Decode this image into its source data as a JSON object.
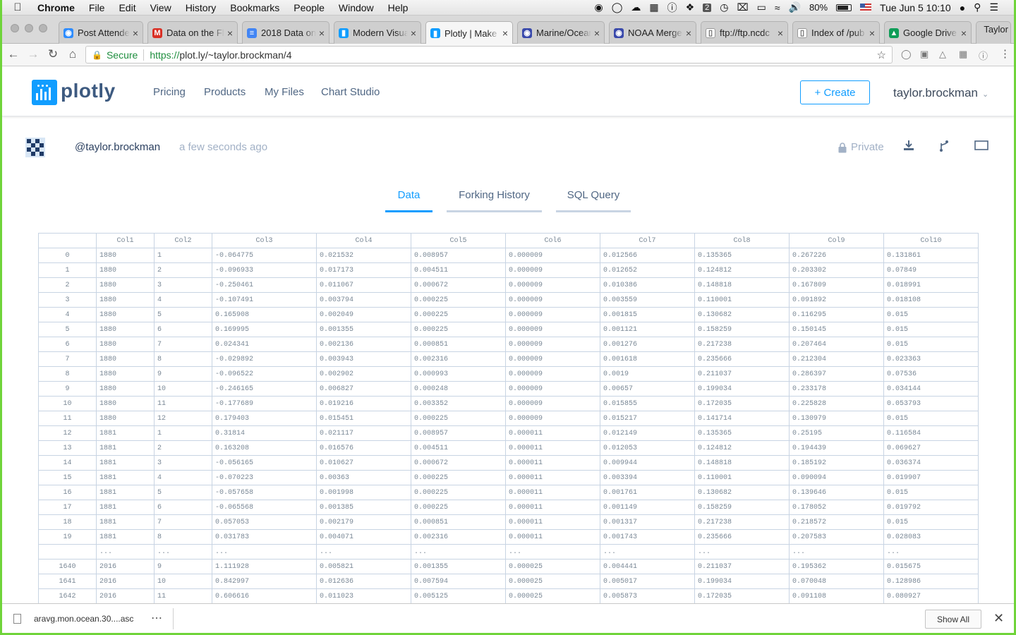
{
  "menubar": {
    "app": "Chrome",
    "items": [
      "File",
      "Edit",
      "View",
      "History",
      "Bookmarks",
      "People",
      "Window",
      "Help"
    ],
    "battery": "80%",
    "clock": "Tue Jun 5  10:10",
    "badge": "2"
  },
  "tabs": [
    {
      "title": "Post Attendee",
      "favicon_color": "#2d8cff",
      "favicon_glyph": "◉"
    },
    {
      "title": "Data on the Fly",
      "favicon_color": "#d93025",
      "favicon_glyph": "M"
    },
    {
      "title": "2018 Data on",
      "favicon_color": "#4285f4",
      "favicon_glyph": "≡"
    },
    {
      "title": "Modern Visual",
      "favicon_color": "#119dff",
      "favicon_glyph": "▮"
    },
    {
      "title": "Plotly | Make",
      "favicon_color": "#119dff",
      "favicon_glyph": "▮"
    },
    {
      "title": "Marine/Ocean",
      "favicon_color": "#3949ab",
      "favicon_glyph": "◉"
    },
    {
      "title": "NOAA Merged",
      "favicon_color": "#3949ab",
      "favicon_glyph": "◉"
    },
    {
      "title": "ftp://ftp.ncdc",
      "favicon_color": "#ffffff",
      "favicon_glyph": "▯"
    },
    {
      "title": "Index of /pub",
      "favicon_color": "#ffffff",
      "favicon_glyph": "▯"
    },
    {
      "title": "Google Drive",
      "favicon_color": "#0f9d58",
      "favicon_glyph": "▲"
    },
    {
      "title": "",
      "favicon_color": "#ffffff",
      "favicon_glyph": ""
    }
  ],
  "profile_name": "Taylor",
  "address": {
    "secure_label": "Secure",
    "scheme": "https://",
    "rest": "plot.ly/~taylor.brockman/4"
  },
  "site": {
    "logo_text": "plotly",
    "nav": [
      "Pricing",
      "Products",
      "My Files",
      "Chart Studio"
    ],
    "create_label": "+ Create",
    "user": "taylor.brockman"
  },
  "meta": {
    "username": "@taylor.brockman",
    "timeago": "a few seconds ago",
    "privacy": "Private"
  },
  "page_tabs": [
    "Data",
    "Forking History",
    "SQL Query"
  ],
  "table": {
    "columns": [
      "",
      "Col1",
      "Col2",
      "Col3",
      "Col4",
      "Col5",
      "Col6",
      "Col7",
      "Col8",
      "Col9",
      "Col10"
    ],
    "rows": [
      [
        "0",
        "1880",
        "1",
        "-0.064775",
        "0.021532",
        "0.008957",
        "0.000009",
        "0.012566",
        "0.135365",
        "0.267226",
        "0.131861"
      ],
      [
        "1",
        "1880",
        "2",
        "-0.096933",
        "0.017173",
        "0.004511",
        "0.000009",
        "0.012652",
        "0.124812",
        "0.203302",
        "0.07849"
      ],
      [
        "2",
        "1880",
        "3",
        "-0.250461",
        "0.011067",
        "0.000672",
        "0.000009",
        "0.010386",
        "0.148818",
        "0.167809",
        "0.018991"
      ],
      [
        "3",
        "1880",
        "4",
        "-0.107491",
        "0.003794",
        "0.000225",
        "0.000009",
        "0.003559",
        "0.110001",
        "0.091892",
        "0.018108"
      ],
      [
        "4",
        "1880",
        "5",
        "0.165908",
        "0.002049",
        "0.000225",
        "0.000009",
        "0.001815",
        "0.130682",
        "0.116295",
        "0.015"
      ],
      [
        "5",
        "1880",
        "6",
        "0.169995",
        "0.001355",
        "0.000225",
        "0.000009",
        "0.001121",
        "0.158259",
        "0.150145",
        "0.015"
      ],
      [
        "6",
        "1880",
        "7",
        "0.024341",
        "0.002136",
        "0.000851",
        "0.000009",
        "0.001276",
        "0.217238",
        "0.207464",
        "0.015"
      ],
      [
        "7",
        "1880",
        "8",
        "-0.029892",
        "0.003943",
        "0.002316",
        "0.000009",
        "0.001618",
        "0.235666",
        "0.212304",
        "0.023363"
      ],
      [
        "8",
        "1880",
        "9",
        "-0.096522",
        "0.002902",
        "0.000993",
        "0.000009",
        "0.0019",
        "0.211037",
        "0.286397",
        "0.07536"
      ],
      [
        "9",
        "1880",
        "10",
        "-0.246165",
        "0.006827",
        "0.000248",
        "0.000009",
        "0.00657",
        "0.199034",
        "0.233178",
        "0.034144"
      ],
      [
        "10",
        "1880",
        "11",
        "-0.177689",
        "0.019216",
        "0.003352",
        "0.000009",
        "0.015855",
        "0.172035",
        "0.225828",
        "0.053793"
      ],
      [
        "11",
        "1880",
        "12",
        "0.179403",
        "0.015451",
        "0.000225",
        "0.000009",
        "0.015217",
        "0.141714",
        "0.130979",
        "0.015"
      ],
      [
        "12",
        "1881",
        "1",
        "0.31814",
        "0.021117",
        "0.008957",
        "0.000011",
        "0.012149",
        "0.135365",
        "0.25195",
        "0.116584"
      ],
      [
        "13",
        "1881",
        "2",
        "0.163208",
        "0.016576",
        "0.004511",
        "0.000011",
        "0.012053",
        "0.124812",
        "0.194439",
        "0.069627"
      ],
      [
        "14",
        "1881",
        "3",
        "-0.056165",
        "0.010627",
        "0.000672",
        "0.000011",
        "0.009944",
        "0.148818",
        "0.185192",
        "0.036374"
      ],
      [
        "15",
        "1881",
        "4",
        "-0.070223",
        "0.00363",
        "0.000225",
        "0.000011",
        "0.003394",
        "0.110001",
        "0.090094",
        "0.019907"
      ],
      [
        "16",
        "1881",
        "5",
        "-0.057658",
        "0.001998",
        "0.000225",
        "0.000011",
        "0.001761",
        "0.130682",
        "0.139646",
        "0.015"
      ],
      [
        "17",
        "1881",
        "6",
        "-0.065568",
        "0.001385",
        "0.000225",
        "0.000011",
        "0.001149",
        "0.158259",
        "0.178052",
        "0.019792"
      ],
      [
        "18",
        "1881",
        "7",
        "0.057053",
        "0.002179",
        "0.000851",
        "0.000011",
        "0.001317",
        "0.217238",
        "0.218572",
        "0.015"
      ],
      [
        "19",
        "1881",
        "8",
        "0.031783",
        "0.004071",
        "0.002316",
        "0.000011",
        "0.001743",
        "0.235666",
        "0.207583",
        "0.028083"
      ],
      [
        "",
        "...",
        "...",
        "...",
        "...",
        "...",
        "...",
        "...",
        "...",
        "...",
        "..."
      ],
      [
        "1640",
        "2016",
        "9",
        "1.111928",
        "0.005821",
        "0.001355",
        "0.000025",
        "0.004441",
        "0.211037",
        "0.195362",
        "0.015675"
      ],
      [
        "1641",
        "2016",
        "10",
        "0.842997",
        "0.012636",
        "0.007594",
        "0.000025",
        "0.005017",
        "0.199034",
        "0.070048",
        "0.128986"
      ],
      [
        "1642",
        "2016",
        "11",
        "0.606616",
        "0.011023",
        "0.005125",
        "0.000025",
        "0.005873",
        "0.172035",
        "0.091108",
        "0.080927"
      ]
    ]
  },
  "download": {
    "filename": "aravg.mon.ocean.30....asc",
    "show_all": "Show All"
  }
}
